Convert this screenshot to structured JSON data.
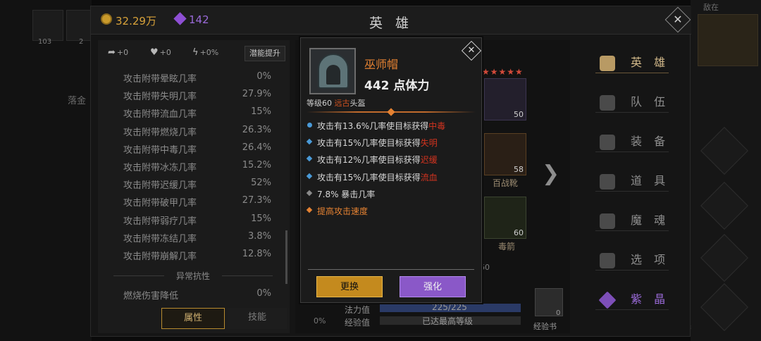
{
  "background": {
    "left_slots": [
      "103",
      "2"
    ],
    "left_text": "落金",
    "right_label": "敌在",
    "watermark": "2e23a0f8-9082b8f1979bf3"
  },
  "header": {
    "gold": "32.29万",
    "gems": "142",
    "title": "英 雄"
  },
  "attributes": {
    "buffs": [
      {
        "icon": "fist-icon",
        "value": "+0"
      },
      {
        "icon": "heart-icon",
        "value": "+0"
      },
      {
        "icon": "lightning-icon",
        "value": "+0%"
      }
    ],
    "potential_button": "潜能提升",
    "rows": [
      {
        "label": "攻击附带晕眩几率",
        "value": "0%"
      },
      {
        "label": "攻击附带失明几率",
        "value": "27.9%"
      },
      {
        "label": "攻击附带流血几率",
        "value": "15%"
      },
      {
        "label": "攻击附带燃烧几率",
        "value": "26.3%"
      },
      {
        "label": "攻击附带中毒几率",
        "value": "26.4%"
      },
      {
        "label": "攻击附带冰冻几率",
        "value": "15.2%"
      },
      {
        "label": "攻击附带迟缓几率",
        "value": "52%"
      },
      {
        "label": "攻击附带破甲几率",
        "value": "27.3%"
      },
      {
        "label": "攻击附带弱疗几率",
        "value": "15%"
      },
      {
        "label": "攻击附带冻结几率",
        "value": "3.8%"
      },
      {
        "label": "攻击附带崩解几率",
        "value": "12.8%"
      }
    ],
    "section_title": "异常抗性",
    "resist_row": {
      "label": "燃烧伤害降低",
      "value": "0%"
    },
    "tabs": {
      "attributes": "属性",
      "skills": "技能"
    }
  },
  "hero": {
    "stars": "★★★★★",
    "slots": [
      {
        "level": "50",
        "name": ""
      },
      {
        "level": "58",
        "name": "百战靴"
      },
      {
        "level": "60",
        "name": "毒箭"
      }
    ],
    "slot_60_extra": "60",
    "stats": [
      {
        "label": "法力值",
        "value": "225/225"
      },
      {
        "label": "经验值",
        "value": "已达最高等级"
      }
    ],
    "percent": "0%",
    "xp_book": {
      "label": "经验书",
      "count": "0"
    }
  },
  "menu": [
    {
      "label": "英 雄",
      "icon": "hero-icon",
      "state": "active"
    },
    {
      "label": "队 伍",
      "icon": "flag-icon",
      "state": "normal"
    },
    {
      "label": "装 备",
      "icon": "helmet-icon",
      "state": "normal"
    },
    {
      "label": "道 具",
      "icon": "bag-icon",
      "state": "normal"
    },
    {
      "label": "魔 魂",
      "icon": "flame-icon",
      "state": "normal"
    },
    {
      "label": "选 项",
      "icon": "gear-icon",
      "state": "normal"
    },
    {
      "label": "紫 晶",
      "icon": "crystal-icon",
      "state": "purple"
    }
  ],
  "item": {
    "name": "巫师帽",
    "stamina": "442 点体力",
    "level_prefix": "等级60",
    "quality": "远古",
    "type": "头盔",
    "effects": [
      {
        "prefix": "攻击有13.6%几率使目标获得",
        "highlight": "中毒",
        "bullet_color": "#4a9ad8",
        "style": "normal"
      },
      {
        "prefix": "攻击有15%几率使目标获得",
        "highlight": "失明",
        "bullet_color": "#4a9ad8",
        "style": "normal"
      },
      {
        "prefix": "攻击有12%几率使目标获得",
        "highlight": "迟缓",
        "bullet_color": "#4a9ad8",
        "style": "normal"
      },
      {
        "prefix": "攻击有15%几率使目标获得",
        "highlight": "流血",
        "bullet_color": "#4a9ad8",
        "style": "normal"
      },
      {
        "prefix": "7.8% 暴击几率",
        "highlight": "",
        "bullet_color": "#8a8a8a",
        "style": "normal"
      },
      {
        "prefix": "提高攻击速度",
        "highlight": "",
        "bullet_color": "#e58232",
        "style": "orange"
      }
    ],
    "buttons": {
      "replace": "更换",
      "enhance": "强化"
    }
  }
}
